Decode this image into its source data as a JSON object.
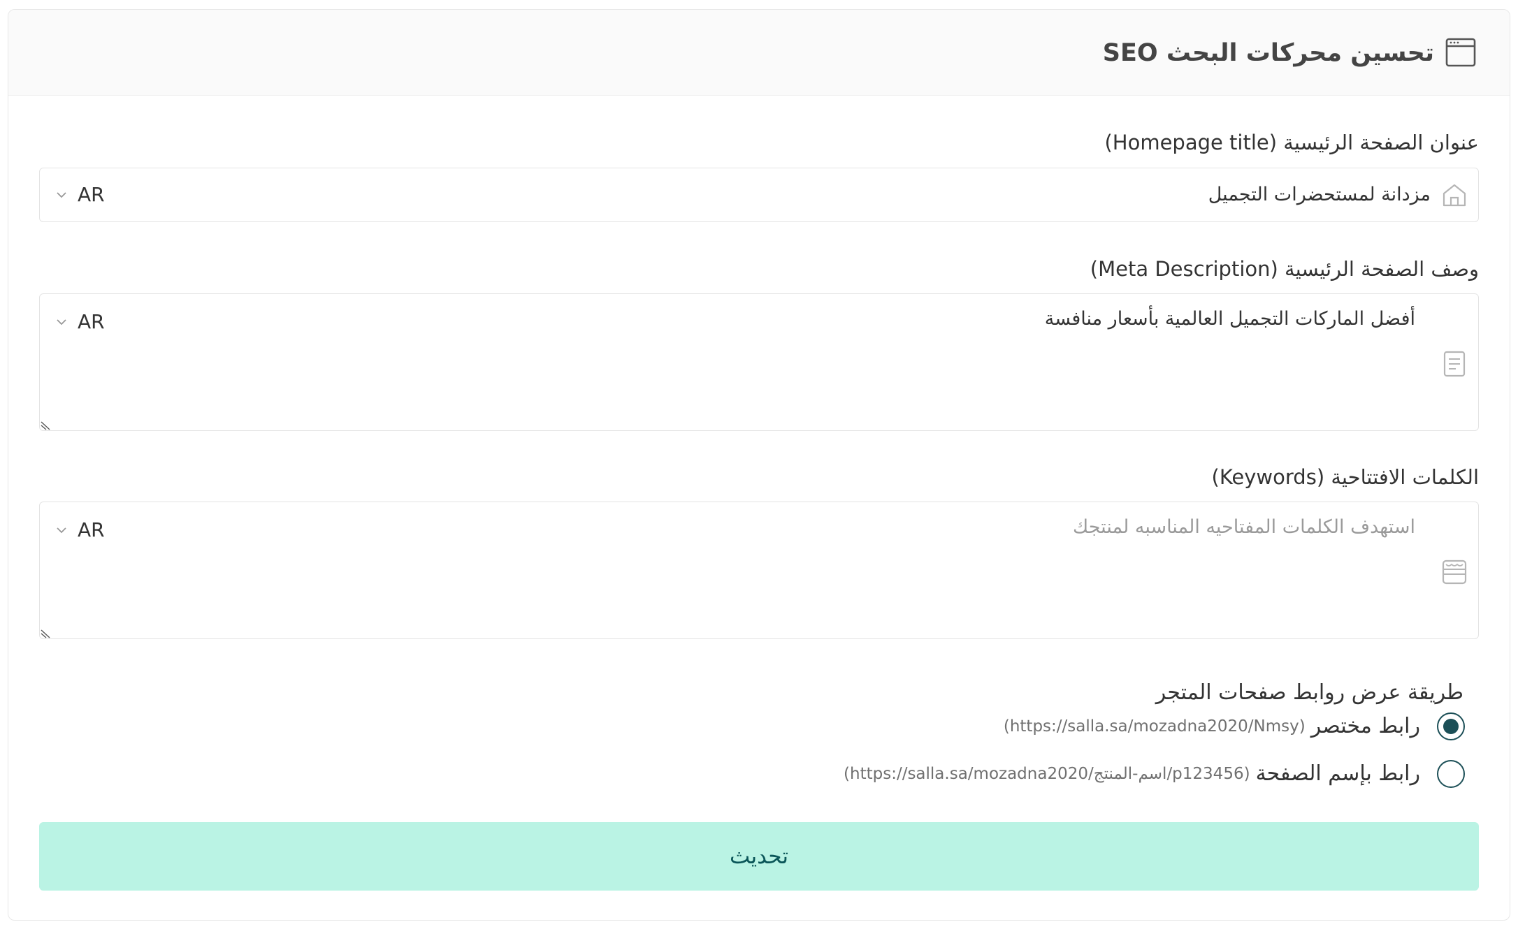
{
  "header": {
    "title": "تحسين محركات البحث SEO",
    "icon": "browser-window-icon"
  },
  "homepage_title": {
    "label": "عنوان الصفحة الرئيسية (Homepage title)",
    "value": "مزدانة لمستحضرات التجميل",
    "icon": "home-icon",
    "language": "AR"
  },
  "meta_description": {
    "label": "وصف الصفحة الرئيسية (Meta Description)",
    "value": "أفضل الماركات التجميل العالمية بأسعار منافسة",
    "icon": "document-lines-icon",
    "language": "AR"
  },
  "keywords": {
    "label": "الكلمات الافتتاحية (Keywords)",
    "placeholder": "استهدف الكلمات المفتاحيه المناسبه لمنتجك",
    "icon": "storefront-icon",
    "language": "AR"
  },
  "url_display": {
    "label": "طريقة عرض روابط صفحات المتجر",
    "options": [
      {
        "label": "رابط مختصر",
        "hint": "(https://salla.sa/mozadna2020/Nmsy)",
        "selected": true
      },
      {
        "label": "رابط بإسم الصفحة",
        "hint": "(https://salla.sa/mozadna2020/اسم-المنتج/p123456)",
        "selected": false
      }
    ]
  },
  "submit": {
    "label": "تحديث"
  },
  "colors": {
    "accent_dark": "#1c4f57",
    "button_bg": "#baf3e4",
    "button_text": "#0a5558",
    "header_bg": "#fafafa",
    "border": "#e4e4e4"
  }
}
